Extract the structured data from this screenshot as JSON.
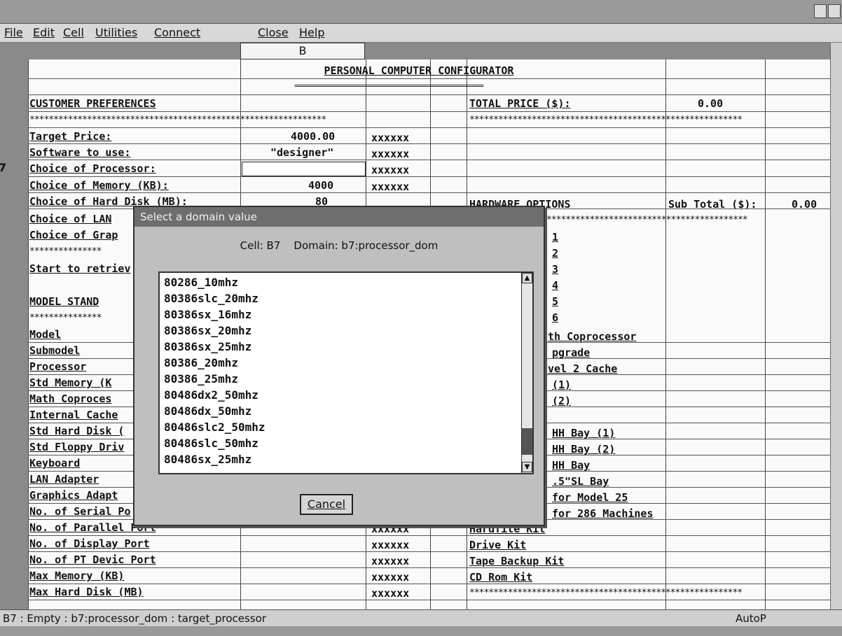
{
  "menu": [
    "File",
    "Edit",
    "Cell",
    "Utilities",
    "Connect",
    "Close",
    "Help"
  ],
  "column_header": "B",
  "row_number": "7",
  "sheet": {
    "title": "PERSONAL COMPUTER CONFIGURATOR",
    "customer_preferences": "CUSTOMER PREFERENCES",
    "total_price_label": "TOTAL PRICE ($):",
    "total_price_value": "0.00",
    "target_price_label": "Target Price:",
    "target_price_value": "4000.00",
    "software_label": "Software to use:",
    "software_value": "\"designer\"",
    "processor_label": "Choice of Processor:",
    "memory_label": "Choice of Memory (KB):",
    "memory_value": "4000",
    "hard_disk_label": "Choice of Hard Disk (MB):",
    "hard_disk_value": "80",
    "lan_label": "Choice of LAN",
    "graphics_label": "Choice of Grap",
    "start_label": "Start to retriev",
    "model_standard": "MODEL STAND",
    "hardware_options": "HARDWARE OPTIONS",
    "sub_total_label": "Sub Total ($):",
    "sub_total_value": "0.00",
    "xxxxxx": "xxxxxx",
    "left_labels": [
      "Model",
      "Submodel",
      "Processor",
      "Std Memory (K",
      "Math Coproces",
      "Internal Cache",
      "Std Hard Disk (",
      "Std Floppy Driv",
      "Keyboard",
      "LAN Adapter",
      "Graphics Adapt",
      "No. of Serial Po",
      "No. of Parallel Port",
      "No. of Display Port",
      "No. of PT Devic Port",
      "Max Memory (KB)",
      "Max Hard Disk (MB)"
    ],
    "right_labels": [
      "1",
      "2",
      "3",
      "4",
      "5",
      "6",
      "th Coprocessor",
      "pgrade",
      "vel 2 Cache",
      "(1)",
      "(2)",
      "",
      "HH Bay (1)",
      "HH Bay (2)",
      "HH Bay",
      ".5\"SL Bay",
      "for Model 25",
      "for 286 Machines",
      "Hardfile Kit",
      "Drive Kit",
      "Tape Backup Kit",
      "CD Rom Kit"
    ]
  },
  "dialog": {
    "title": "Select a domain value",
    "cell_label": "Cell: B7",
    "domain_label": "Domain: b7:processor_dom",
    "items": [
      "80286_10mhz",
      "80386slc_20mhz",
      "80386sx_16mhz",
      "80386sx_20mhz",
      "80386sx_25mhz",
      "80386_20mhz",
      "80386_25mhz",
      "80486dx2_50mhz",
      "80486dx_50mhz",
      "80486slc2_50mhz",
      "80486slc_50mhz",
      "80486sx_25mhz"
    ],
    "cancel_label": "Cancel"
  },
  "status": {
    "text": "B7 : Empty : b7:processor_dom : target_processor",
    "mode": "AutoP"
  }
}
